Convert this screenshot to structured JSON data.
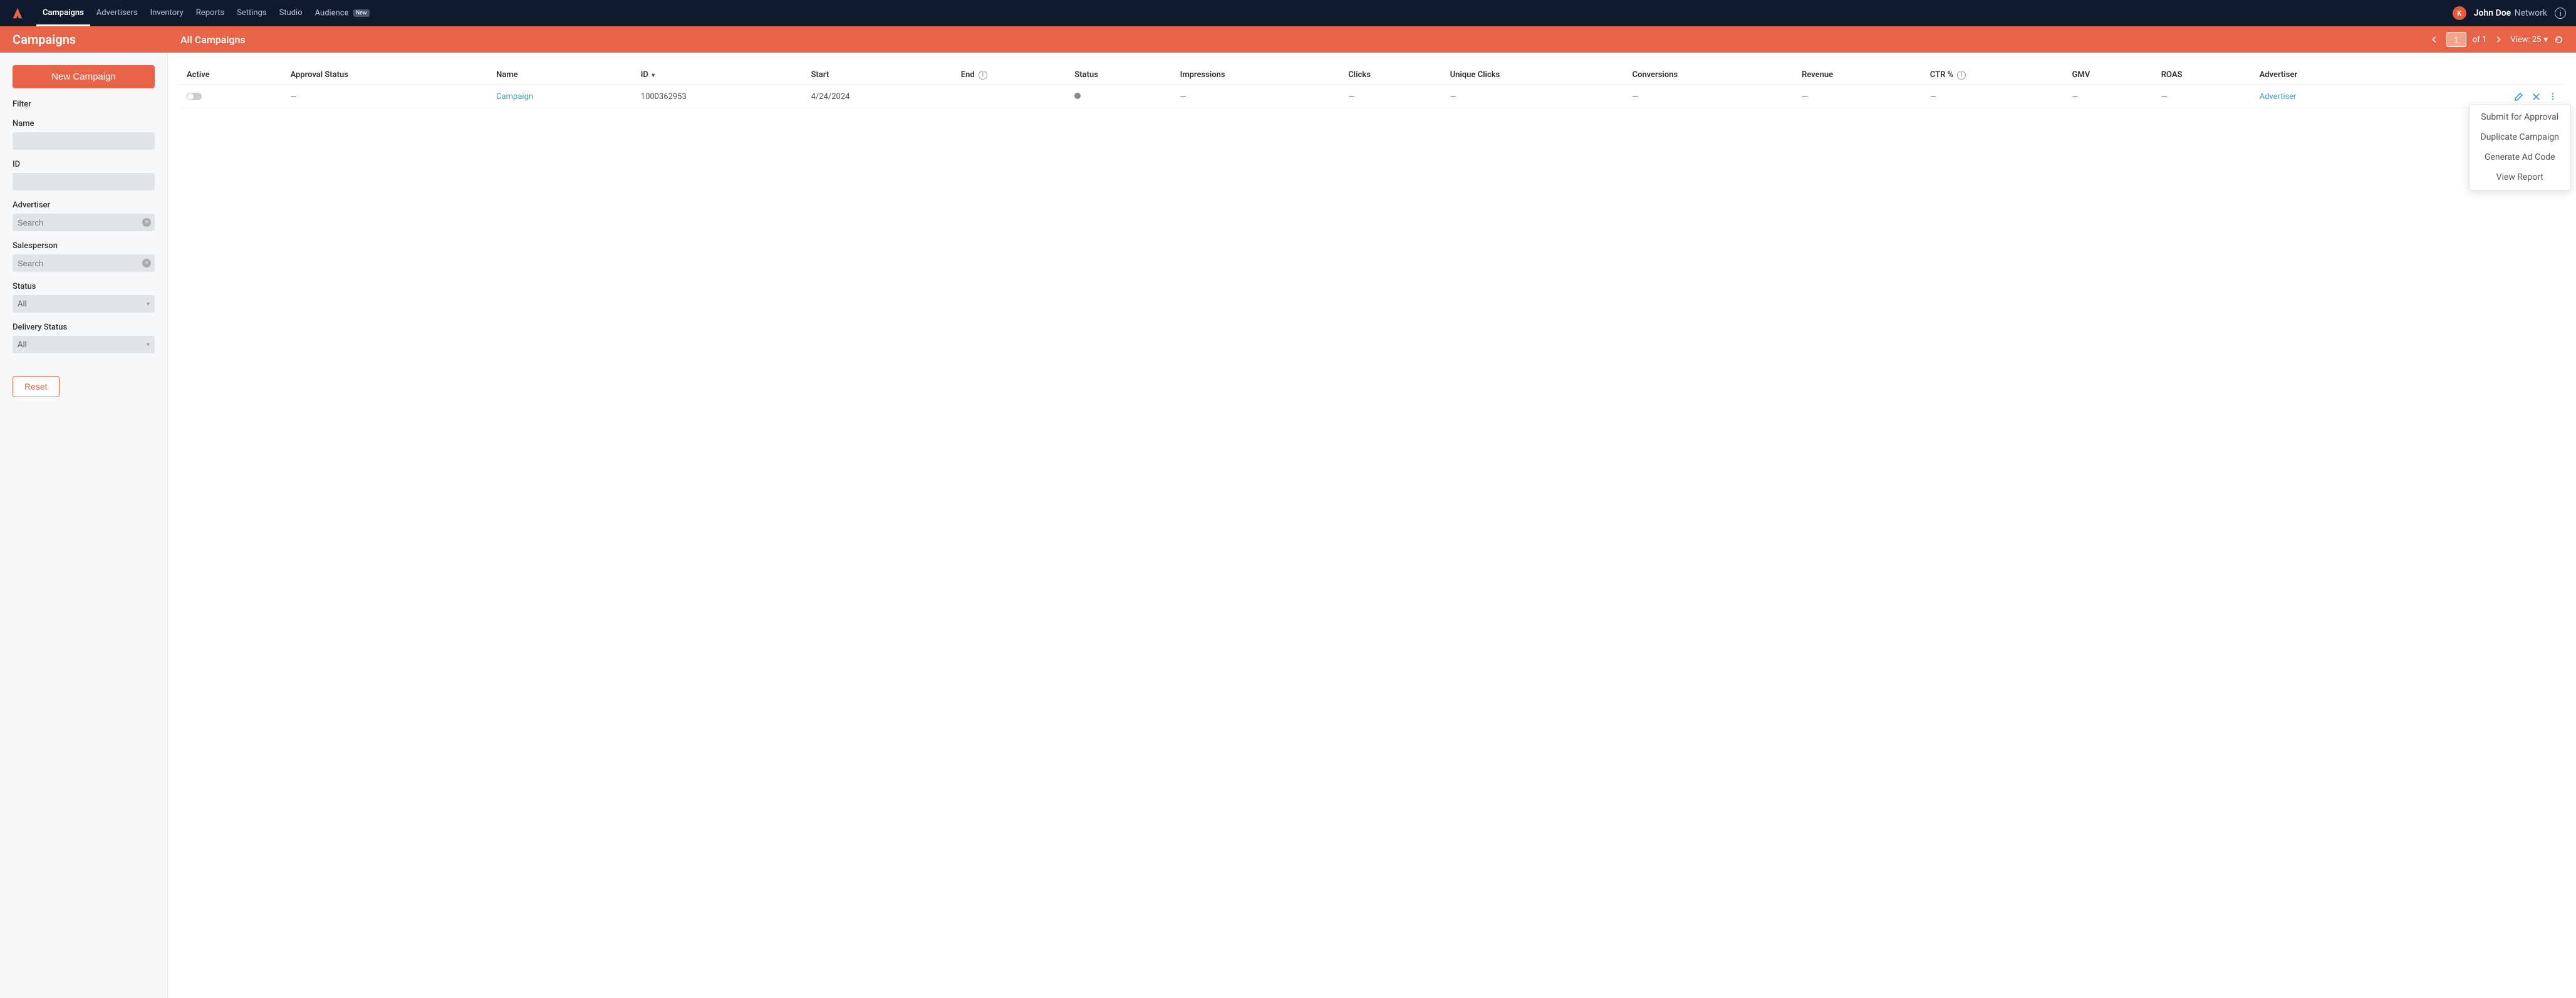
{
  "topnav": {
    "items": [
      {
        "label": "Campaigns",
        "active": true
      },
      {
        "label": "Advertisers"
      },
      {
        "label": "Inventory"
      },
      {
        "label": "Reports"
      },
      {
        "label": "Settings"
      },
      {
        "label": "Studio"
      },
      {
        "label": "Audience",
        "badge": "New"
      }
    ],
    "user_name": "John Doe",
    "user_context": "Network",
    "avatar_initial": "K"
  },
  "subheader": {
    "page_title": "Campaigns",
    "section_title": "All Campaigns",
    "page_current": "1",
    "page_of": "of 1",
    "view_label": "View: 25"
  },
  "sidebar": {
    "new_button": "New Campaign",
    "filter_heading": "Filter",
    "filters": {
      "name_label": "Name",
      "id_label": "ID",
      "advertiser_label": "Advertiser",
      "advertiser_placeholder": "Search",
      "salesperson_label": "Salesperson",
      "salesperson_placeholder": "Search",
      "status_label": "Status",
      "status_value": "All",
      "delivery_label": "Delivery Status",
      "delivery_value": "All"
    },
    "reset": "Reset"
  },
  "table": {
    "columns": {
      "active": "Active",
      "approval": "Approval Status",
      "name": "Name",
      "id": "ID",
      "start": "Start",
      "end": "End",
      "status": "Status",
      "impressions": "Impressions",
      "clicks": "Clicks",
      "unique_clicks": "Unique Clicks",
      "conversions": "Conversions",
      "revenue": "Revenue",
      "ctr": "CTR %",
      "gmv": "GMV",
      "roas": "ROAS",
      "advertiser": "Advertiser"
    },
    "rows": [
      {
        "approval": "—",
        "name": "Campaign",
        "id": "1000362953",
        "start": "4/24/2024",
        "end": "",
        "impressions": "—",
        "clicks": "—",
        "unique_clicks": "—",
        "conversions": "—",
        "revenue": "—",
        "ctr": "—",
        "gmv": "—",
        "roas": "—",
        "advertiser": "Advertiser"
      }
    ]
  },
  "dropdown": [
    "Submit for Approval",
    "Duplicate Campaign",
    "Generate Ad Code",
    "View Report"
  ]
}
